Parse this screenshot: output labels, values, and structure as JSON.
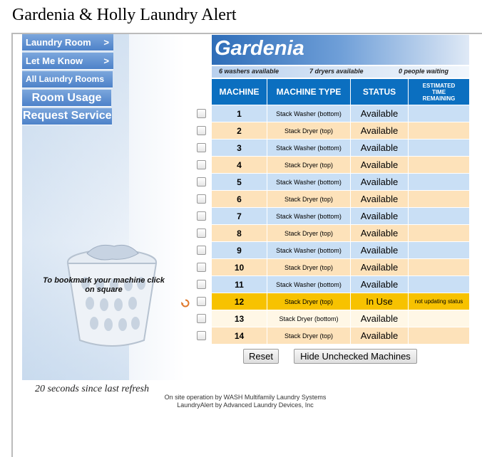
{
  "page_title": "Gardenia & Holly Laundry Alert",
  "nav": {
    "laundry_room": "Laundry Room",
    "let_me_know": "Let Me Know",
    "arrow": ">",
    "all_rooms": "All Laundry Rooms",
    "room_usage": "Room Usage",
    "request_service": "Request Service"
  },
  "bookmark_hint": "To bookmark your machine click on square",
  "room": {
    "name": "Gardenia",
    "washers_available": "6 washers available",
    "dryers_available": "7 dryers available",
    "people_waiting": "0 people waiting"
  },
  "table": {
    "headers": [
      "MACHINE",
      "MACHINE TYPE",
      "STATUS",
      "ESTIMATED TIME REMAINING"
    ],
    "rows": [
      {
        "machine": "1",
        "type": "Stack Washer (bottom)",
        "status": "Available",
        "estimate": "",
        "row_color": "#c9dff5"
      },
      {
        "machine": "2",
        "type": "Stack Dryer (top)",
        "status": "Available",
        "estimate": "",
        "row_color": "#fde2ba"
      },
      {
        "machine": "3",
        "type": "Stack Washer (bottom)",
        "status": "Available",
        "estimate": "",
        "row_color": "#c9dff5"
      },
      {
        "machine": "4",
        "type": "Stack Dryer (top)",
        "status": "Available",
        "estimate": "",
        "row_color": "#fde2ba"
      },
      {
        "machine": "5",
        "type": "Stack Washer (bottom)",
        "status": "Available",
        "estimate": "",
        "row_color": "#c9dff5"
      },
      {
        "machine": "6",
        "type": "Stack Dryer (top)",
        "status": "Available",
        "estimate": "",
        "row_color": "#fde2ba"
      },
      {
        "machine": "7",
        "type": "Stack Washer (bottom)",
        "status": "Available",
        "estimate": "",
        "row_color": "#c9dff5"
      },
      {
        "machine": "8",
        "type": "Stack Dryer (top)",
        "status": "Available",
        "estimate": "",
        "row_color": "#fde2ba"
      },
      {
        "machine": "9",
        "type": "Stack Washer (bottom)",
        "status": "Available",
        "estimate": "",
        "row_color": "#c9dff5"
      },
      {
        "machine": "10",
        "type": "Stack Dryer (top)",
        "status": "Available",
        "estimate": "",
        "row_color": "#fde2ba"
      },
      {
        "machine": "11",
        "type": "Stack Washer (bottom)",
        "status": "Available",
        "estimate": "",
        "row_color": "#c9dff5"
      },
      {
        "machine": "12",
        "type": "Stack Dryer (top)",
        "status": "In Use",
        "estimate": "not updating status",
        "row_color": "#f7c200"
      },
      {
        "machine": "13",
        "type": "Stack Dryer (bottom)",
        "status": "Available",
        "estimate": "",
        "row_color": "#fff7e6"
      },
      {
        "machine": "14",
        "type": "Stack Dryer (top)",
        "status": "Available",
        "estimate": "",
        "row_color": "#fde2ba"
      }
    ]
  },
  "buttons": {
    "reset": "Reset",
    "hide_unchecked": "Hide Unchecked Machines"
  },
  "refresh_text": "20 seconds since last refresh",
  "footer": {
    "line1": "On site operation by WASH Multifamily Laundry Systems",
    "line2": "LaundryAlert by Advanced Laundry Devices, Inc"
  },
  "colors": {
    "header_blue": "#0b6fc0",
    "nav_blue": "#4d82c9",
    "washer_row": "#c9dff5",
    "dryer_row": "#fde2ba",
    "in_use_row": "#f7c200"
  },
  "icons": {
    "spinner": "refresh-spinner-icon",
    "basket": "laundry-basket-icon"
  }
}
